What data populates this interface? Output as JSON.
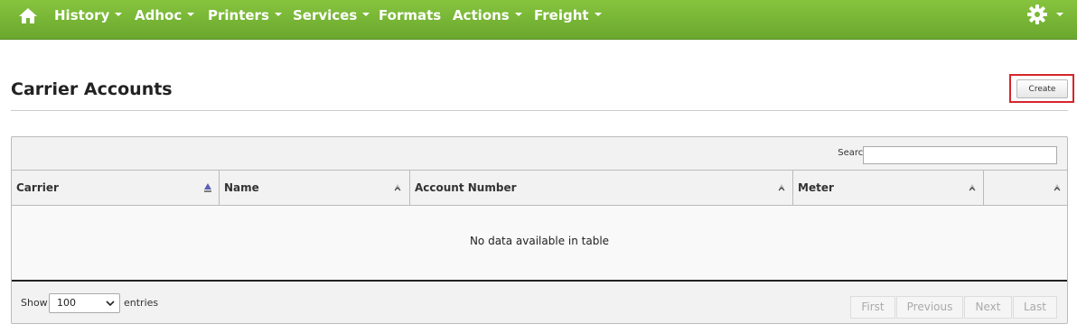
{
  "nav": {
    "items": [
      {
        "label": "History",
        "caret": true
      },
      {
        "label": "Adhoc",
        "caret": true
      },
      {
        "label": "Printers",
        "caret": true
      },
      {
        "label": "Services",
        "caret": true
      },
      {
        "label": "Formats",
        "caret": false
      },
      {
        "label": "Actions",
        "caret": true
      },
      {
        "label": "Freight",
        "caret": true
      }
    ],
    "icons": [
      "home-icon",
      "gear-icon"
    ],
    "color": "#7ab936"
  },
  "page": {
    "title": "Carrier Accounts",
    "create_label": "Create"
  },
  "table": {
    "search_label": "Search:",
    "search_value": "",
    "columns": [
      "Carrier",
      "Name",
      "Account Number",
      "Meter",
      ""
    ],
    "sorted_column": "Carrier",
    "empty_message": "No data available in table",
    "show_label": "Show",
    "page_length": "100",
    "entries_label": "entries",
    "pagination": [
      "First",
      "Previous",
      "Next",
      "Last"
    ]
  }
}
